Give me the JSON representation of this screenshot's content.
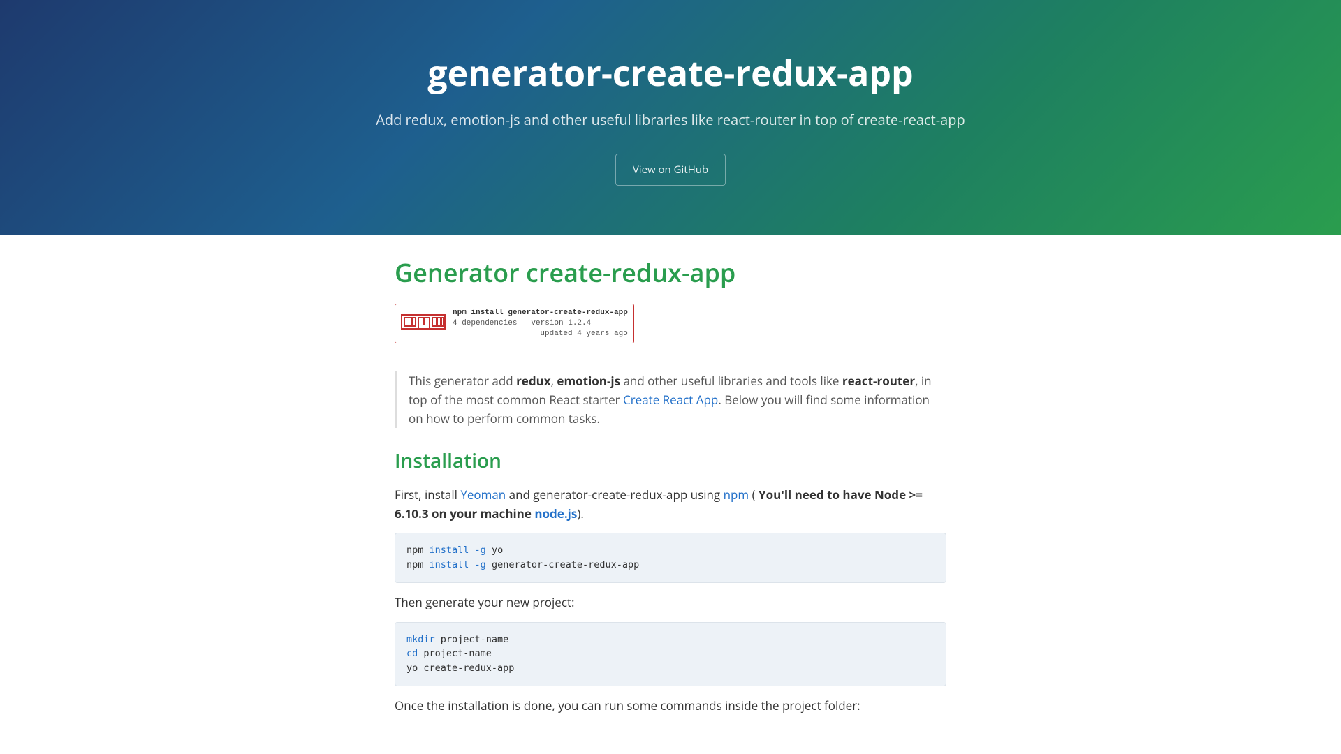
{
  "header": {
    "title": "generator-create-redux-app",
    "subtitle": "Add redux, emotion-js and other useful libraries like react-router in top of create-react-app",
    "github_btn": "View on GitHub"
  },
  "content": {
    "h1": "Generator create-redux-app",
    "npm_badge": {
      "cmd": "npm install generator-create-redux-app",
      "deps": "4 dependencies",
      "version": "version 1.2.4",
      "updated": "updated 4 years ago"
    },
    "blockquote": {
      "p1a": "This generator add ",
      "b1": "redux",
      "p1b": ", ",
      "b2": "emotion-js",
      "p1c": " and other useful libraries and tools like ",
      "b3": "react-router",
      "p1d": ", in top of the most common React starter ",
      "link": "Create React App",
      "p1e": ". Below you will find some information on how to perform common tasks."
    },
    "h2_install": "Installation",
    "install_p": {
      "a": "First, install ",
      "yeoman": "Yeoman",
      "b": " and generator-create-redux-app using ",
      "npm": "npm",
      "c": " ( ",
      "bold": "You'll need to have Node >= 6.10.3 on your machine ",
      "nodejs": "node.js",
      "d": ")."
    },
    "code1": {
      "l1a": "npm ",
      "l1b": "install ",
      "l1c": "-g",
      "l1d": " yo",
      "l2a": "npm ",
      "l2b": "install ",
      "l2c": "-g",
      "l2d": " generator-create-redux-app"
    },
    "then_p": "Then generate your new project:",
    "code2": {
      "l1a": "mkdir ",
      "l1b": "project-name",
      "l2a": "cd ",
      "l2b": "project-name",
      "l3": "yo create-redux-app"
    },
    "once_p": "Once the installation is done, you can run some commands inside the project folder:"
  }
}
